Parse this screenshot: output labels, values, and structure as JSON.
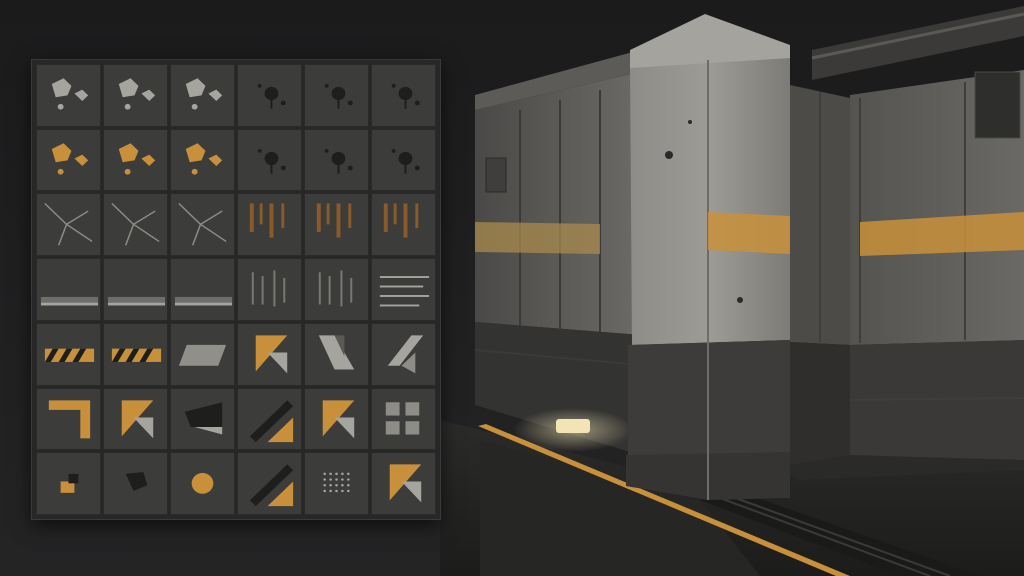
{
  "colors": {
    "background": "#1d1d1e",
    "atlas_panel": "#272727",
    "tile": "#3c3c3b",
    "concrete": "#8b8985",
    "dark_metal": "#3a3a38",
    "hazard_orange": "#c8903a",
    "rust": "#8a5a2a",
    "floor_light": "#e9dcae"
  },
  "atlas": {
    "rows": 7,
    "columns": 6,
    "tiles": [
      {
        "name": "tile-peeled-paint-light-1",
        "icon": "peeled-paint-icon"
      },
      {
        "name": "tile-peeled-paint-light-2",
        "icon": "peeled-paint-icon"
      },
      {
        "name": "tile-peeled-paint-light-3",
        "icon": "peeled-paint-icon"
      },
      {
        "name": "tile-stain-splatter-1",
        "icon": "splatter-icon"
      },
      {
        "name": "tile-stain-splatter-2",
        "icon": "splatter-icon"
      },
      {
        "name": "tile-stain-splatter-3",
        "icon": "splatter-icon"
      },
      {
        "name": "tile-peeled-paint-orange-1",
        "icon": "peeled-paint-icon"
      },
      {
        "name": "tile-peeled-paint-orange-2",
        "icon": "peeled-paint-icon"
      },
      {
        "name": "tile-peeled-paint-grey",
        "icon": "peeled-paint-icon"
      },
      {
        "name": "tile-splatter-dots-1",
        "icon": "splatter-icon"
      },
      {
        "name": "tile-splatter-dots-2",
        "icon": "splatter-icon"
      },
      {
        "name": "tile-splatter-dots-3",
        "icon": "splatter-icon"
      },
      {
        "name": "tile-crack-1",
        "icon": "crack-icon"
      },
      {
        "name": "tile-crack-2",
        "icon": "crack-icon"
      },
      {
        "name": "tile-crack-3",
        "icon": "crack-icon"
      },
      {
        "name": "tile-rust-drip-1",
        "icon": "rust-drip-icon"
      },
      {
        "name": "tile-rust-drip-2",
        "icon": "rust-drip-icon"
      },
      {
        "name": "tile-rust-drip-3",
        "icon": "rust-drip-icon"
      },
      {
        "name": "tile-edge-grime-1",
        "icon": "grime-icon"
      },
      {
        "name": "tile-edge-grime-2",
        "icon": "grime-icon"
      },
      {
        "name": "tile-edge-grime-3",
        "icon": "grime-icon"
      },
      {
        "name": "tile-vertical-streaks-1",
        "icon": "streaks-icon"
      },
      {
        "name": "tile-vertical-streaks-2",
        "icon": "streaks-icon"
      },
      {
        "name": "tile-horizontal-scratches",
        "icon": "scratches-icon"
      },
      {
        "name": "tile-hazard-stripe-1",
        "icon": "hazard-stripe-icon"
      },
      {
        "name": "tile-hazard-stripe-2",
        "icon": "hazard-stripe-icon"
      },
      {
        "name": "tile-worn-plate",
        "icon": "worn-plate-icon"
      },
      {
        "name": "tile-corner-triangle",
        "icon": "triangle-icon"
      },
      {
        "name": "tile-folded-plate",
        "icon": "folded-plate-icon"
      },
      {
        "name": "tile-arrow-plate",
        "icon": "arrow-plate-icon"
      },
      {
        "name": "tile-orange-corner-bracket",
        "icon": "corner-bracket-icon"
      },
      {
        "name": "tile-dark-triangles",
        "icon": "triangle-icon"
      },
      {
        "name": "tile-dark-wedge",
        "icon": "wedge-icon"
      },
      {
        "name": "tile-diagonal-split",
        "icon": "diagonal-icon"
      },
      {
        "name": "tile-orange-triangle",
        "icon": "triangle-icon"
      },
      {
        "name": "tile-crosses",
        "icon": "cross-icon"
      },
      {
        "name": "tile-small-square",
        "icon": "square-icon"
      },
      {
        "name": "tile-dark-blot",
        "icon": "blot-icon"
      },
      {
        "name": "tile-orange-circle",
        "icon": "circle-icon"
      },
      {
        "name": "tile-orange-diagonal",
        "icon": "diagonal-icon"
      },
      {
        "name": "tile-dot-grid",
        "icon": "dot-grid-icon"
      },
      {
        "name": "tile-grey-triangle",
        "icon": "triangle-icon"
      }
    ]
  }
}
